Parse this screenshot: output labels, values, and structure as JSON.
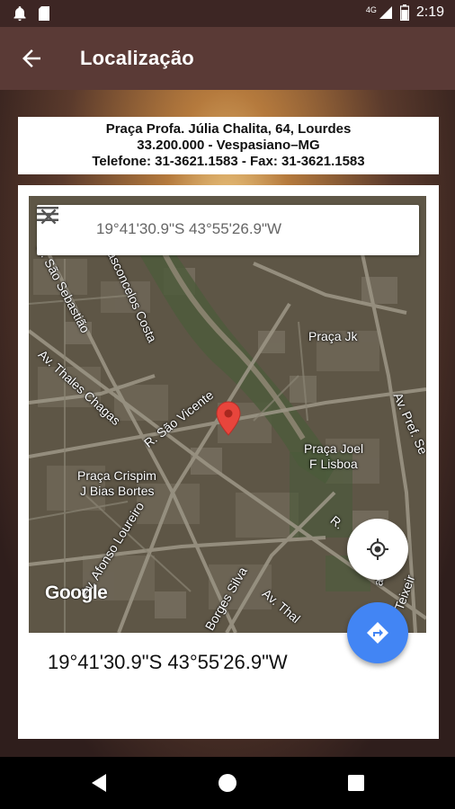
{
  "status_bar": {
    "time": "2:19",
    "network": "4G"
  },
  "app_bar": {
    "title": "Localização"
  },
  "address": {
    "line1": "Praça Profa. Júlia Chalita, 64, Lourdes",
    "line2": "33.200.000 - Vespasiano–MG",
    "line3": "Telefone: 31-3621.1583 - Fax: 31-3621.1583"
  },
  "map": {
    "search_value": "19°41'30.9\"S 43°55'26.9\"W",
    "logo": "Google",
    "labels": {
      "r_sao_sebastiao": "R. São Sebastião",
      "vasconcelos_costa": "Vasconcelos Costa",
      "praca_jk": "Praça Jk",
      "av_thales_chagas": "Av. Thales Chagas",
      "r_sao_vicente": "R. São Vicente",
      "av_pref_se": "Av. Pref. Se",
      "praca_joel_1": "Praça Joel",
      "praca_joel_2": "F Lisboa",
      "praca_crispim_1": "Praça Crispim",
      "praca_crispim_2": "J Bias Bortes",
      "av_afonso_loureiro": "Av. Afonso Loureiro",
      "r_r": "R.",
      "borges_silva": "Borges Silva",
      "av_thales": "Av. Thal",
      "teixeira": "iri Teixeir",
      "ata": "ata"
    },
    "pin_color": "#e8453c"
  },
  "coordinates_display": "19°41'30.9\"S 43°55'26.9\"W",
  "icons": {
    "back": "arrow-left",
    "menu": "hamburger",
    "close": "x",
    "my_location": "crosshair",
    "directions": "turn-arrow"
  },
  "colors": {
    "app_bar": "#5a3a36",
    "accent_fab": "#4285f4"
  }
}
